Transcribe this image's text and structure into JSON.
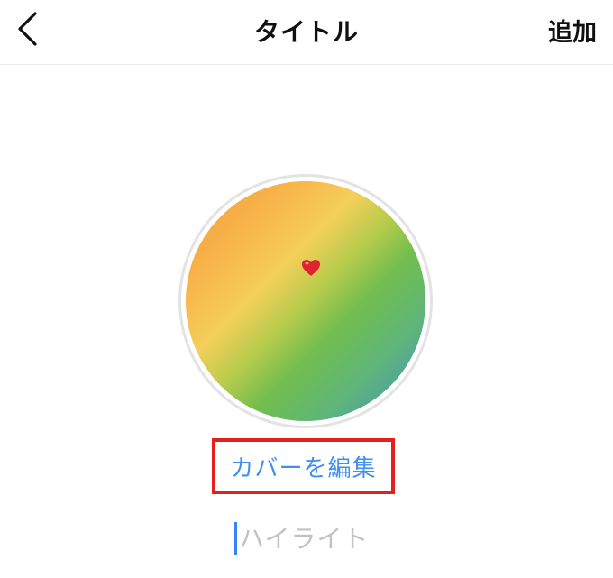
{
  "header": {
    "title": "タイトル",
    "add_label": "追加",
    "back_icon": "chevron-left-icon"
  },
  "cover": {
    "emoji_icon": "heart-icon",
    "heart_color": "#e0242f",
    "edit_label": "カバーを編集",
    "highlight_color": "#e3201b",
    "link_color": "#3f8ef0"
  },
  "name_input": {
    "value": "",
    "placeholder": "ハイライト"
  }
}
